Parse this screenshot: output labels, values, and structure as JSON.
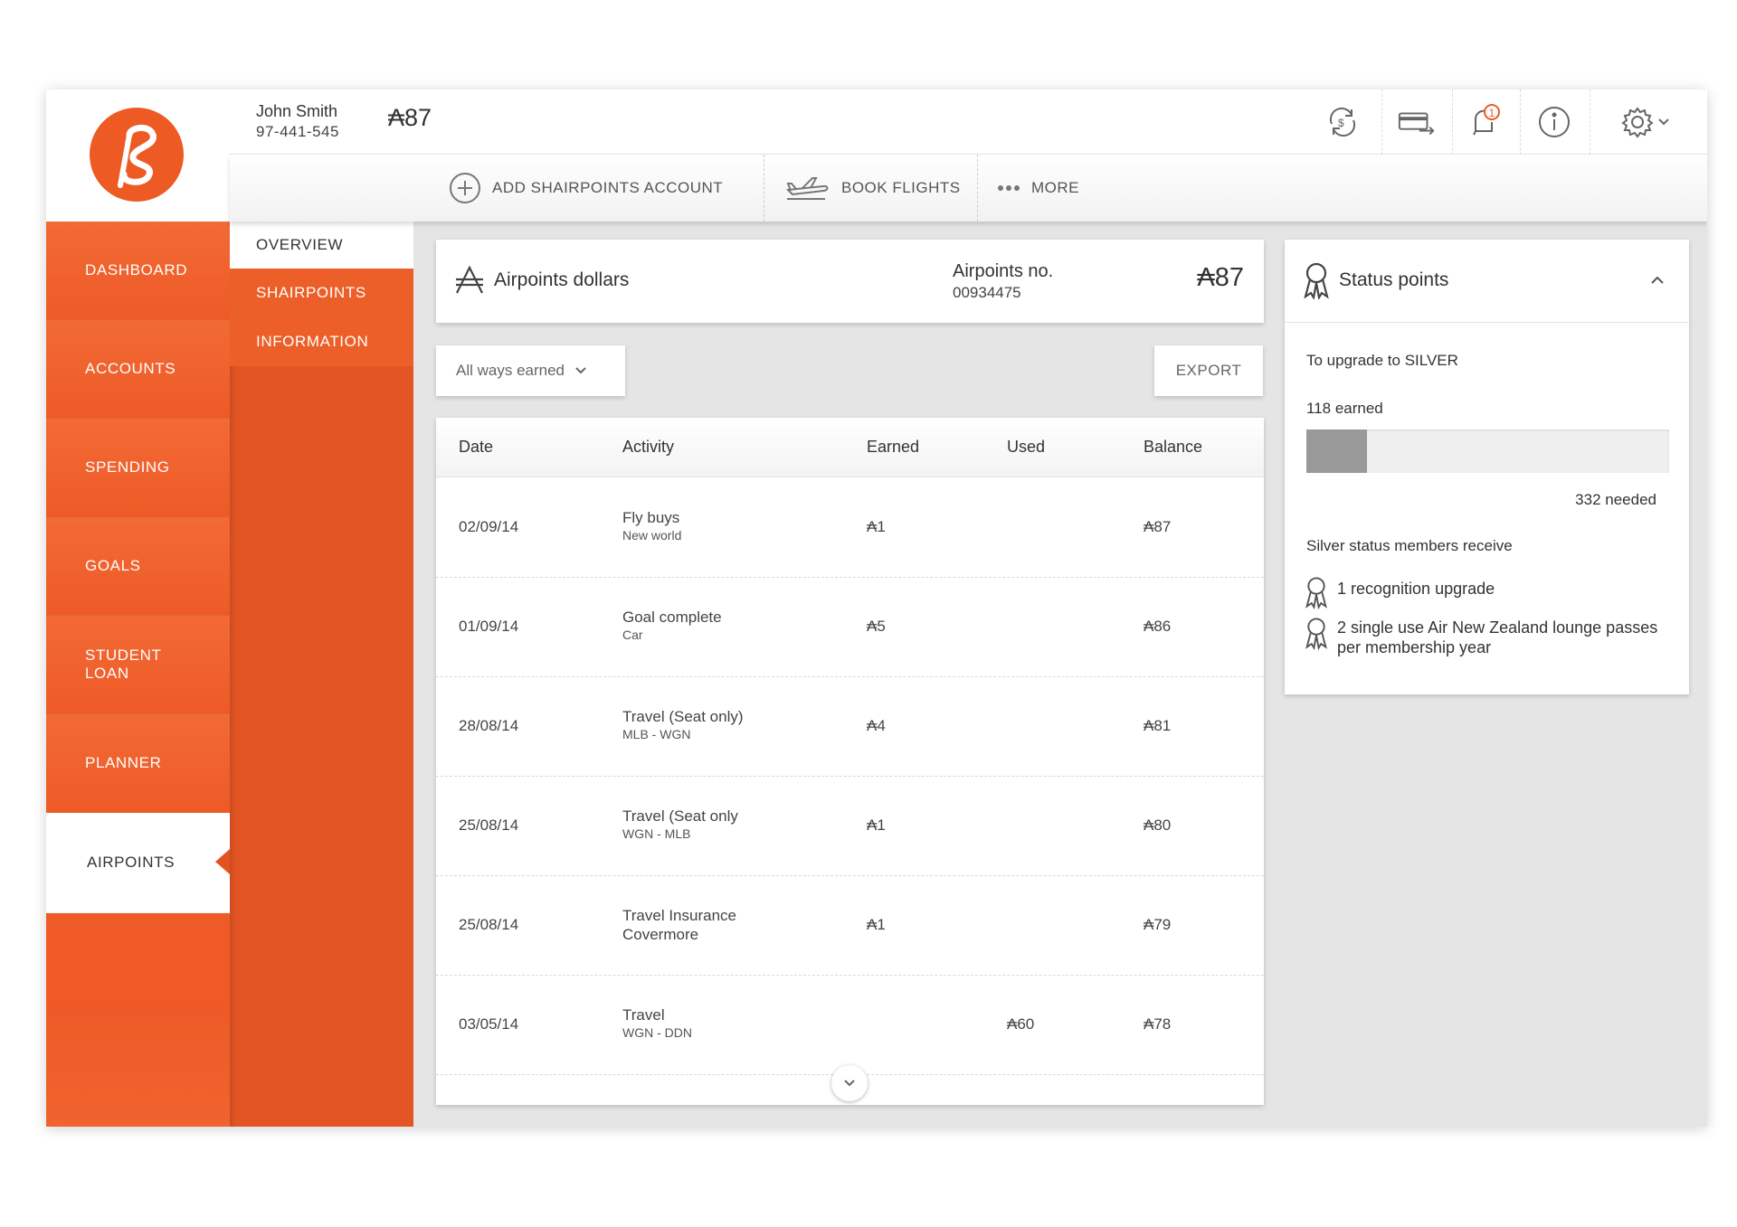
{
  "logo": {
    "glyph": "ℓ",
    "letter": "S"
  },
  "header": {
    "user_name": "John Smith",
    "user_phone": "97-441-545",
    "balance": "₳87",
    "notification_count": "1"
  },
  "actions": {
    "add_account": "ADD SHAIRPOINTS ACCOUNT",
    "book_flights": "BOOK FLIGHTS",
    "more": "MORE"
  },
  "nav": {
    "dashboard": "DASHBOARD",
    "accounts": "ACCOUNTS",
    "spending": "SPENDING",
    "goals": "GOALS",
    "student_loan_1": "STUDENT",
    "student_loan_2": "LOAN",
    "planner": "PLANNER",
    "airpoints": "AIRPOINTS"
  },
  "subnav": {
    "overview": "OVERVIEW",
    "shairpoints": "SHAIRPOINTS",
    "information": "INFORMATION"
  },
  "airpoints_card": {
    "title": "Airpoints dollars",
    "number_label": "Airpoints no.",
    "number_value": "00934475",
    "balance": "₳87"
  },
  "filter": {
    "label": "All ways earned"
  },
  "export_label": "EXPORT",
  "table": {
    "headers": {
      "date": "Date",
      "activity": "Activity",
      "earned": "Earned",
      "used": "Used",
      "balance": "Balance"
    },
    "rows": [
      {
        "date": "02/09/14",
        "activity": "Fly buys",
        "detail": "New world",
        "earned": "₳1",
        "used": "",
        "balance": "₳87"
      },
      {
        "date": "01/09/14",
        "activity": "Goal complete",
        "detail": "Car",
        "earned": "₳5",
        "used": "",
        "balance": "₳86"
      },
      {
        "date": "28/08/14",
        "activity": "Travel (Seat only)",
        "detail": "MLB - WGN",
        "earned": "₳4",
        "used": "",
        "balance": "₳81"
      },
      {
        "date": "25/08/14",
        "activity": "Travel (Seat only",
        "detail": "WGN - MLB",
        "earned": "₳1",
        "used": "",
        "balance": "₳80"
      },
      {
        "date": "25/08/14",
        "activity": "Travel Insurance",
        "detail": "Covermore",
        "earned": "₳1",
        "used": "",
        "balance": "₳79"
      },
      {
        "date": "03/05/14",
        "activity": "Travel",
        "detail": "WGN - DDN",
        "earned": "",
        "used": "₳60",
        "balance": "₳78"
      }
    ]
  },
  "status": {
    "title": "Status points",
    "upgrade_label": "To upgrade to SILVER",
    "earned_label": "118 earned",
    "needed_label": "332 needed",
    "progress_fraction": 0.166,
    "benefits_title": "Silver status members receive",
    "benefit_1": "1 recognition upgrade",
    "benefit_2": "2 single use Air New Zealand lounge passes per membership year"
  }
}
